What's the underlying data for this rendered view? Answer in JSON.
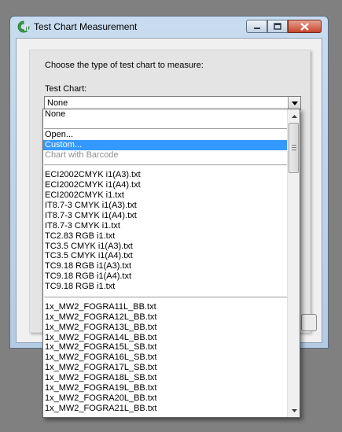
{
  "window": {
    "title": "Test Chart Measurement",
    "icon": "app-icon",
    "buttons": {
      "minimize": "minimize-icon",
      "maximize": "maximize-icon",
      "close": "close-icon"
    }
  },
  "dialog": {
    "prompt": "Choose the type of test chart to measure:",
    "test_chart_label": "Test Chart:",
    "selected_value": "None"
  },
  "dropdown": {
    "items": [
      {
        "label": "None",
        "state": "normal"
      },
      {
        "label": "",
        "state": "separator"
      },
      {
        "label": "Open...",
        "state": "normal"
      },
      {
        "label": "Custom...",
        "state": "selected"
      },
      {
        "label": "Chart with Barcode",
        "state": "disabled"
      },
      {
        "label": "",
        "state": "separator"
      },
      {
        "label": "ECI2002CMYK i1(A3).txt",
        "state": "normal"
      },
      {
        "label": "ECI2002CMYK i1(A4).txt",
        "state": "normal"
      },
      {
        "label": "ECI2002CMYK i1.txt",
        "state": "normal"
      },
      {
        "label": "IT8.7-3 CMYK i1(A3).txt",
        "state": "normal"
      },
      {
        "label": "IT8.7-3 CMYK i1(A4).txt",
        "state": "normal"
      },
      {
        "label": "IT8.7-3 CMYK i1.txt",
        "state": "normal"
      },
      {
        "label": "TC2.83 RGB i1.txt",
        "state": "normal"
      },
      {
        "label": "TC3.5 CMYK i1(A3).txt",
        "state": "normal"
      },
      {
        "label": "TC3.5 CMYK i1(A4).txt",
        "state": "normal"
      },
      {
        "label": "TC9.18 RGB i1(A3).txt",
        "state": "normal"
      },
      {
        "label": "TC9.18 RGB i1(A4).txt",
        "state": "normal"
      },
      {
        "label": "TC9.18 RGB i1.txt",
        "state": "normal"
      },
      {
        "label": "",
        "state": "separator"
      },
      {
        "label": "1x_MW2_FOGRA11L_BB.txt",
        "state": "normal"
      },
      {
        "label": "1x_MW2_FOGRA12L_BB.txt",
        "state": "normal"
      },
      {
        "label": "1x_MW2_FOGRA13L_BB.txt",
        "state": "normal"
      },
      {
        "label": "1x_MW2_FOGRA14L_BB.txt",
        "state": "normal"
      },
      {
        "label": "1x_MW2_FOGRA15L_SB.txt",
        "state": "normal"
      },
      {
        "label": "1x_MW2_FOGRA16L_SB.txt",
        "state": "normal"
      },
      {
        "label": "1x_MW2_FOGRA17L_SB.txt",
        "state": "normal"
      },
      {
        "label": "1x_MW2_FOGRA18L_SB.txt",
        "state": "normal"
      },
      {
        "label": "1x_MW2_FOGRA19L_BB.txt",
        "state": "normal"
      },
      {
        "label": "1x_MW2_FOGRA20L_BB.txt",
        "state": "normal"
      },
      {
        "label": "1x_MW2_FOGRA21L_BB.txt",
        "state": "normal"
      }
    ]
  },
  "colors": {
    "selection": "#3399ff",
    "disabled_text": "#8f8f8f"
  }
}
